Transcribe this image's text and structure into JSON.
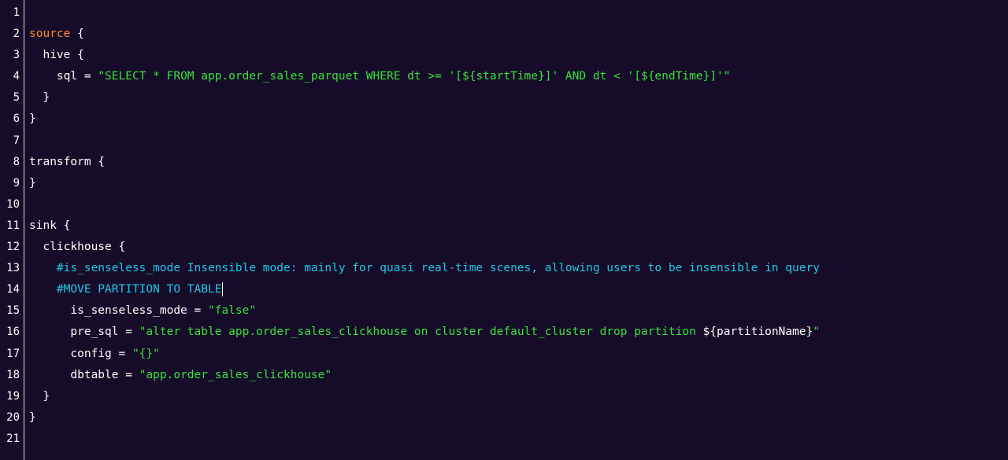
{
  "editor": {
    "lines": [
      {
        "n": "1",
        "tokens": []
      },
      {
        "n": "2",
        "tokens": [
          {
            "t": "source",
            "c": "kw"
          },
          {
            "t": " {",
            "c": "pl"
          }
        ]
      },
      {
        "n": "3",
        "tokens": [
          {
            "t": "  hive {",
            "c": "pl"
          }
        ]
      },
      {
        "n": "4",
        "tokens": [
          {
            "t": "    sql = ",
            "c": "pl"
          },
          {
            "t": "\"SELECT * FROM app.order_sales_parquet WHERE dt >= '[${startTime}]' AND dt < '[${endTime}]'\"",
            "c": "str"
          }
        ]
      },
      {
        "n": "5",
        "tokens": [
          {
            "t": "  }",
            "c": "pl"
          }
        ]
      },
      {
        "n": "6",
        "tokens": [
          {
            "t": "}",
            "c": "pl"
          }
        ]
      },
      {
        "n": "7",
        "tokens": []
      },
      {
        "n": "8",
        "tokens": [
          {
            "t": "transform {",
            "c": "pl"
          }
        ]
      },
      {
        "n": "9",
        "tokens": [
          {
            "t": "}",
            "c": "pl"
          }
        ]
      },
      {
        "n": "10",
        "tokens": []
      },
      {
        "n": "11",
        "tokens": [
          {
            "t": "sink {",
            "c": "pl"
          }
        ]
      },
      {
        "n": "12",
        "tokens": [
          {
            "t": "  clickhouse {",
            "c": "pl"
          }
        ]
      },
      {
        "n": "13",
        "tokens": [
          {
            "t": "    #is_senseless_mode Insensible mode: mainly for quasi real-time scenes, allowing users to be insensible in query",
            "c": "cm"
          }
        ]
      },
      {
        "n": "14",
        "tokens": [
          {
            "t": "    #MOVE PARTITION TO TABLE",
            "c": "cm"
          }
        ],
        "cursor": true
      },
      {
        "n": "15",
        "tokens": [
          {
            "t": "      is_senseless_mode = ",
            "c": "pl"
          },
          {
            "t": "\"false\"",
            "c": "str"
          }
        ]
      },
      {
        "n": "16",
        "tokens": [
          {
            "t": "      pre_sql = ",
            "c": "pl"
          },
          {
            "t": "\"alter table app.order_sales_clickhouse on cluster default_cluster drop partition ",
            "c": "str"
          },
          {
            "t": "${partitionName}",
            "c": "pl"
          },
          {
            "t": "\"",
            "c": "str"
          }
        ]
      },
      {
        "n": "17",
        "tokens": [
          {
            "t": "      config = ",
            "c": "pl"
          },
          {
            "t": "\"{}\"",
            "c": "str"
          }
        ]
      },
      {
        "n": "18",
        "tokens": [
          {
            "t": "      dbtable = ",
            "c": "pl"
          },
          {
            "t": "\"app.order_sales_clickhouse\"",
            "c": "str"
          }
        ]
      },
      {
        "n": "19",
        "tokens": [
          {
            "t": "  }",
            "c": "pl"
          }
        ]
      },
      {
        "n": "20",
        "tokens": [
          {
            "t": "}",
            "c": "pl"
          }
        ]
      },
      {
        "n": "21",
        "tokens": []
      }
    ]
  }
}
